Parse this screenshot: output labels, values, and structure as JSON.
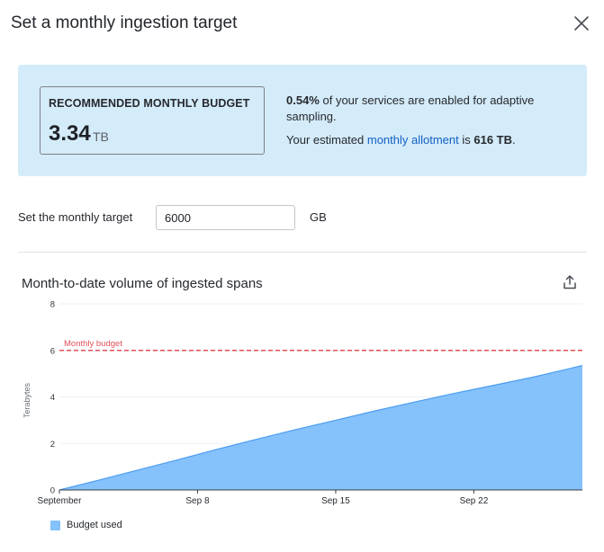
{
  "modal": {
    "title": "Set a monthly ingestion target"
  },
  "recommendation": {
    "label": "RECOMMENDED MONTHLY BUDGET",
    "value": "3.34",
    "unit": "TB",
    "percent": "0.54%",
    "percent_text": " of your services are enabled for adaptive sampling.",
    "allotment_prefix": "Your estimated ",
    "allotment_link": "monthly allotment",
    "allotment_mid": " is ",
    "allotment_value": "616 TB",
    "allotment_suffix": "."
  },
  "target": {
    "label": "Set the monthly target",
    "value": "6000",
    "unit": "GB"
  },
  "chart_section": {
    "title": "Month-to-date volume of ingested spans",
    "export_icon": "export-icon",
    "close_icon": "close-icon"
  },
  "chart_data": {
    "type": "area",
    "title": "Month-to-date volume of ingested spans",
    "ylabel": "Terabytes",
    "xlabel": "",
    "ylim": [
      0,
      8
    ],
    "yticks": [
      0,
      2,
      4,
      6,
      8
    ],
    "xlim": [
      1,
      27.5
    ],
    "xticks": [
      {
        "x": 1,
        "label": "September"
      },
      {
        "x": 8,
        "label": "Sep 8"
      },
      {
        "x": 15,
        "label": "Sep 15"
      },
      {
        "x": 22,
        "label": "Sep 22"
      }
    ],
    "series": [
      {
        "name": "Budget used",
        "color": "#85c1fb",
        "x": [
          1,
          3,
          5,
          7,
          9,
          11,
          13,
          15,
          17,
          19,
          21,
          23,
          25,
          27.5
        ],
        "values": [
          0,
          0.42,
          0.86,
          1.3,
          1.75,
          2.18,
          2.6,
          3.0,
          3.4,
          3.78,
          4.15,
          4.5,
          4.85,
          5.35
        ]
      }
    ],
    "reference_line": {
      "label": "Monthly budget",
      "value": 6,
      "color": "#e0505a"
    },
    "grid": true,
    "legend": "bottom-left"
  }
}
